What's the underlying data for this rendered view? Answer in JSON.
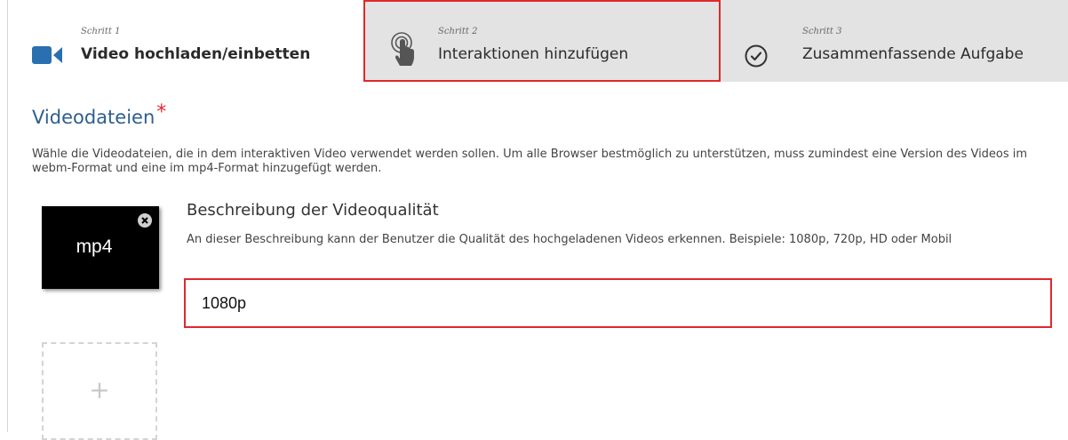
{
  "steps": [
    {
      "number": "Schritt 1",
      "title": "Video hochladen/einbetten",
      "icon": "video-camera-icon",
      "active": true
    },
    {
      "number": "Schritt 2",
      "title": "Interaktionen hinzufügen",
      "icon": "hand-pointer-icon",
      "highlighted": true
    },
    {
      "number": "Schritt 3",
      "title": "Zusammenfassende Aufgabe",
      "icon": "check-circle-icon"
    }
  ],
  "section": {
    "title": "Videodateien",
    "required_mark": "*",
    "description": "Wähle die Videodateien, die in dem interaktiven Video verwendet werden sollen. Um alle Browser bestmöglich zu unterstützen, muss zumindest eine Version des Videos im webm-Format und eine im mp4-Format hinzugefügt werden."
  },
  "files": [
    {
      "label": "mp4",
      "remove_icon": "close-circle-icon"
    }
  ],
  "add_file": {
    "icon": "plus-icon",
    "symbol": "+"
  },
  "quality": {
    "label": "Beschreibung der Videoqualität",
    "description": "An dieser Beschreibung kann der Benutzer die Qualität des hochgeladenen Videos erkennen. Beispiele: 1080p, 720p, HD oder Mobil",
    "value": "1080p"
  },
  "colors": {
    "accent_title": "#2f5f8e",
    "highlight_border": "#e0282e",
    "inactive_tab": "#e3e3e3",
    "video_icon": "#2a6fb0"
  }
}
